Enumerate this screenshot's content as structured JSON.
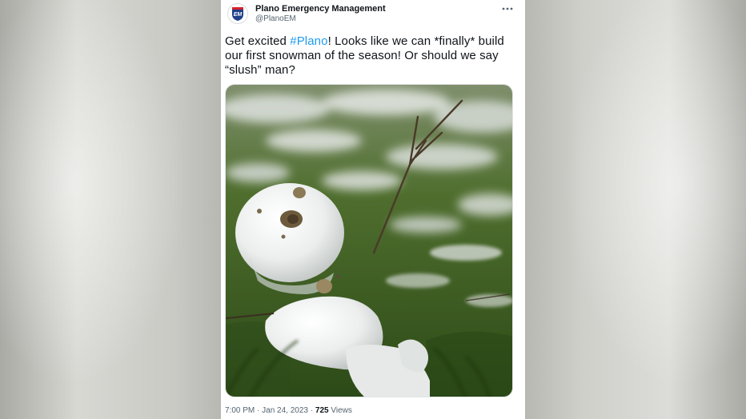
{
  "tweet": {
    "author_name": "Plano Emergency Management",
    "author_handle": "@PlanoEM",
    "avatar_text": "EM",
    "text_before": "Get excited ",
    "hashtag": "#Plano",
    "text_after": "! Looks like we can *finally* build our first snowman of the season! Or should we say “slush” man?",
    "image_icon": "snowman-photo",
    "time": "7:00 PM",
    "separator": "·",
    "date": "Jan 24, 2023",
    "views_count": "725",
    "views_label": "Views",
    "more_icon": "more-icon"
  },
  "colors": {
    "hashtag": "#1d9bf0",
    "text": "#0f1419",
    "muted": "#536471"
  }
}
